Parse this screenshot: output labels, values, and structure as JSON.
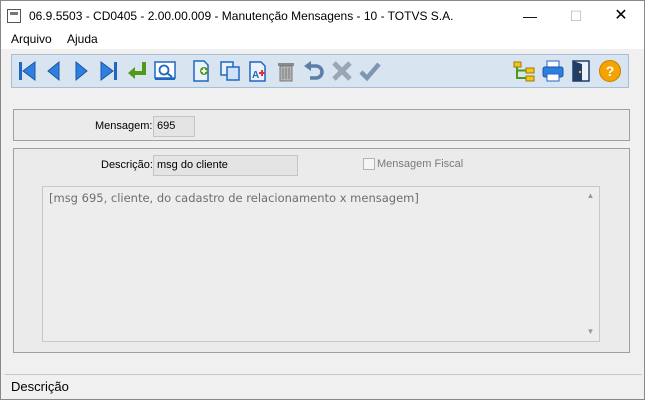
{
  "window": {
    "title": "06.9.5503 - CD0405 - 2.00.00.009 - Manutenção Mensagens - 10 - TOTVS S.A.",
    "controls": {
      "minimize": "—",
      "maximize": "☐",
      "close": "✕"
    }
  },
  "menu": {
    "items": [
      "Arquivo",
      "Ajuda"
    ]
  },
  "toolbar": {
    "buttons": [
      "first-record",
      "previous-record",
      "next-record",
      "last-record",
      "goto-record",
      "search",
      "new-record",
      "copy-record",
      "edit-record",
      "delete-record",
      "undo",
      "cancel",
      "save",
      "tree-view",
      "print",
      "exit",
      "help"
    ]
  },
  "form": {
    "mensagem": {
      "label": "Mensagem:",
      "value": "695"
    },
    "descricao": {
      "label": "Descrição:",
      "value": "msg do cliente"
    },
    "mensagem_fiscal": {
      "label": "Mensagem Fiscal",
      "checked": false
    },
    "memo_text": "[msg 695, cliente, do cadastro de relacionamento x mensagem]"
  },
  "status": {
    "text": "Descrição"
  },
  "colors": {
    "toolbar_bg": "#d9e4f1",
    "icon_blue": "#1f67c2",
    "icon_green": "#4f9a1a",
    "help_orange": "#f5a300"
  }
}
